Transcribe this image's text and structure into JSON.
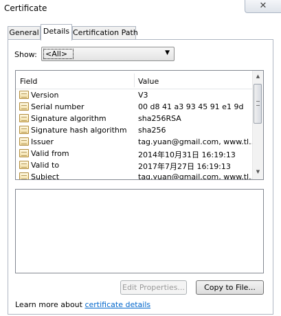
{
  "window": {
    "title": "Certificate",
    "close_glyph": "✕"
  },
  "tabs": [
    {
      "label": "General",
      "active": false
    },
    {
      "label": "Details",
      "active": true
    },
    {
      "label": "Certification Path",
      "active": false
    }
  ],
  "show": {
    "label": "Show:",
    "value": "<All>"
  },
  "list": {
    "columns": {
      "field": "Field",
      "value": "Value"
    },
    "rows": [
      {
        "field": "Version",
        "value": "V3",
        "icon": "certificate-field-icon"
      },
      {
        "field": "Serial number",
        "value": "00 d8 41 a3 93 45 91 e1 9d",
        "icon": "certificate-field-icon"
      },
      {
        "field": "Signature algorithm",
        "value": "sha256RSA",
        "icon": "certificate-field-icon"
      },
      {
        "field": "Signature hash algorithm",
        "value": "sha256",
        "icon": "certificate-field-icon"
      },
      {
        "field": "Issuer",
        "value": "tag.yuan@gmail.com, www.tl...",
        "icon": "certificate-field-icon"
      },
      {
        "field": "Valid from",
        "value": "2014年10月31日 16:19:13",
        "icon": "certificate-field-icon"
      },
      {
        "field": "Valid to",
        "value": "2017年7月27日 16:19:13",
        "icon": "certificate-field-icon"
      },
      {
        "field": "Subject",
        "value": "tag.yuan@gmail.com, www.tl...",
        "icon": "certificate-field-icon"
      }
    ]
  },
  "buttons": {
    "edit_properties": "Edit Properties...",
    "copy_to_file": "Copy to File..."
  },
  "footer": {
    "prefix": "Learn more about ",
    "link": "certificate details"
  }
}
